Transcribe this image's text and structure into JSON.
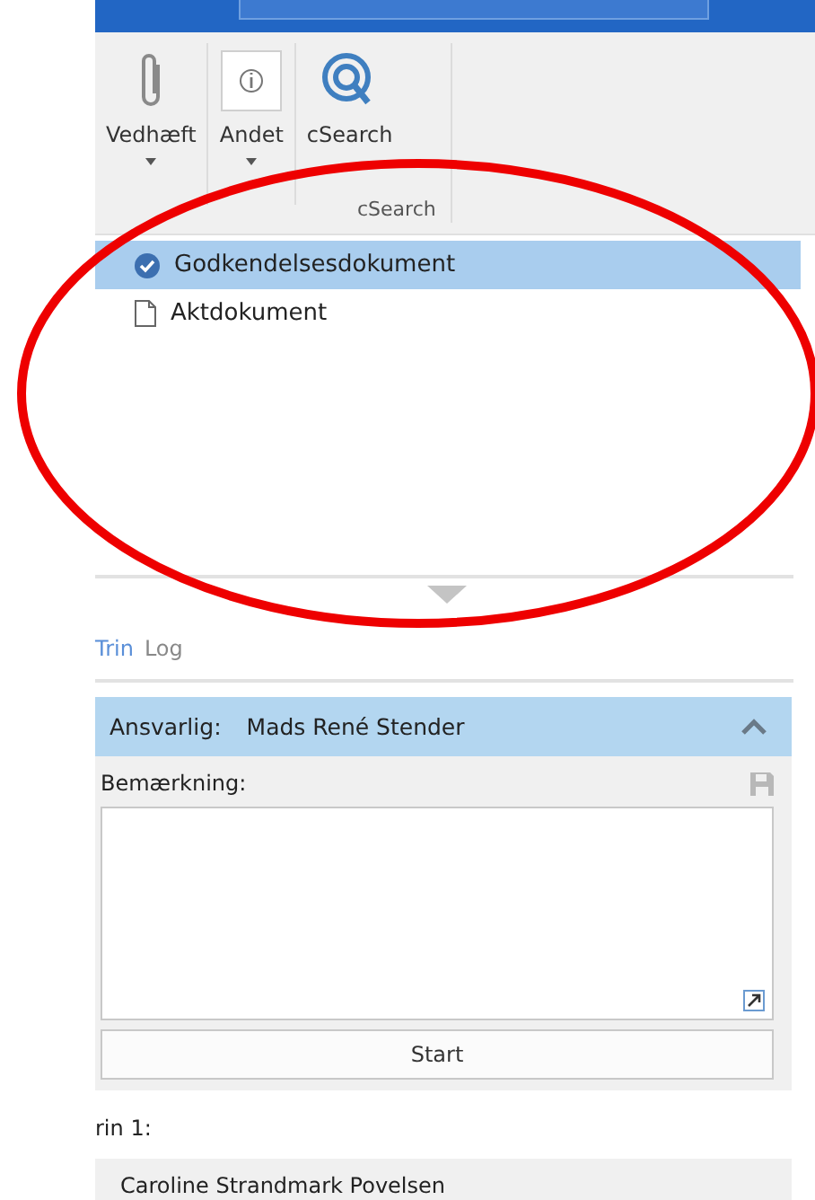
{
  "ribbon": {
    "buttons": [
      {
        "kind": "attach",
        "label": "Vedhæft",
        "dropdown": true
      },
      {
        "kind": "info",
        "label": "Andet",
        "dropdown": true
      },
      {
        "kind": "search",
        "label": "cSearch",
        "dropdown": false
      }
    ],
    "group_label": "cSearch"
  },
  "documents": [
    {
      "kind": "approved",
      "label": "Godkendelsesdokument",
      "selected": true
    },
    {
      "kind": "document",
      "label": "Aktdokument",
      "selected": false
    }
  ],
  "tabs": [
    {
      "label": "Trin",
      "selected": true
    },
    {
      "label": "Log",
      "selected": false
    }
  ],
  "step_card": {
    "responsible_label": "Ansvarlig:",
    "responsible": "Mads René Stender",
    "expanded": true,
    "remark_label": "Bemærkning:",
    "start_button": "Start"
  },
  "next_step": {
    "title": "rin 1:",
    "person": "Caroline Strandmark Povelsen"
  },
  "annotations": [
    {
      "kind": "ellipse"
    }
  ]
}
